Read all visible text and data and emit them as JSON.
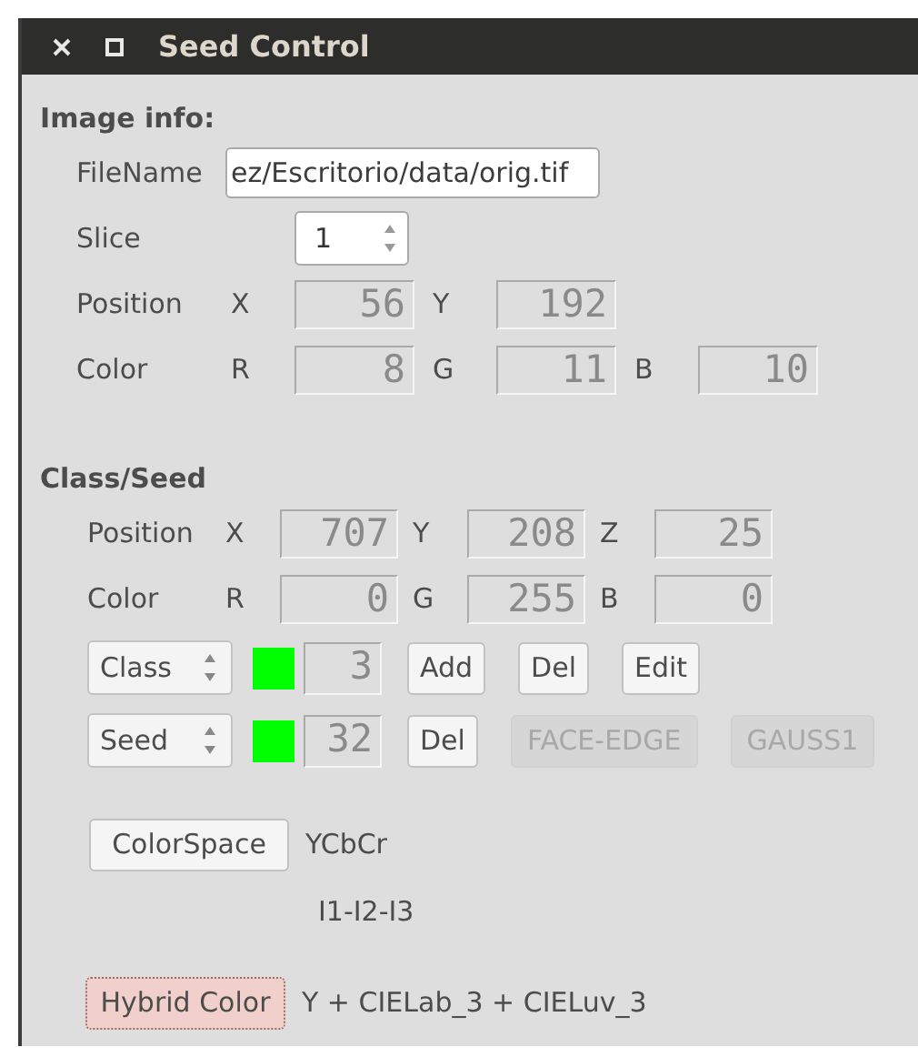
{
  "window": {
    "title": "Seed Control"
  },
  "image_info": {
    "heading": "Image info:",
    "filename": {
      "label": "FileName",
      "value": "ez/Escritorio/data/orig.tif"
    },
    "slice": {
      "label": "Slice",
      "value": "1"
    },
    "position": {
      "label": "Position",
      "fields": [
        {
          "axis": "X",
          "value": "56"
        },
        {
          "axis": "Y",
          "value": "192"
        }
      ]
    },
    "color": {
      "label": "Color",
      "fields": [
        {
          "axis": "R",
          "value": "8"
        },
        {
          "axis": "G",
          "value": "11"
        },
        {
          "axis": "B",
          "value": "10"
        }
      ]
    }
  },
  "class_seed": {
    "heading": "Class/Seed",
    "position": {
      "label": "Position",
      "fields": [
        {
          "axis": "X",
          "value": "707"
        },
        {
          "axis": "Y",
          "value": "208"
        },
        {
          "axis": "Z",
          "value": "25"
        }
      ]
    },
    "color": {
      "label": "Color",
      "fields": [
        {
          "axis": "R",
          "value": "0"
        },
        {
          "axis": "G",
          "value": "255"
        },
        {
          "axis": "B",
          "value": "0"
        }
      ]
    },
    "rows": [
      {
        "selector": "Class",
        "color": "#00ff00",
        "number": "3",
        "buttons": [
          {
            "label": "Add",
            "disabled": false
          },
          {
            "label": "Del",
            "disabled": false
          },
          {
            "label": "Edit",
            "disabled": false
          }
        ]
      },
      {
        "selector": "Seed",
        "color": "#00ff00",
        "number": "32",
        "buttons": [
          {
            "label": "Del",
            "disabled": false
          },
          {
            "label": "FACE-EDGE",
            "disabled": true
          },
          {
            "label": "GAUSS1",
            "disabled": true
          }
        ]
      }
    ]
  },
  "color_space": {
    "button": "ColorSpace",
    "options": [
      "YCbCr",
      "I1-I2-I3"
    ]
  },
  "hybrid": {
    "button": "Hybrid Color",
    "focused": true,
    "value": "Y + CIELab_3 + CIELuv_3"
  }
}
